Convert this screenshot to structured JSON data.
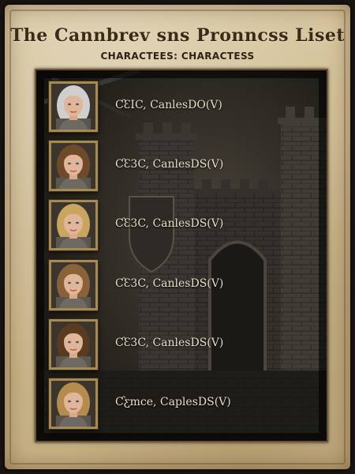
{
  "header": {
    "title": "The Cannbrev sns Pronncss Liset",
    "subtitle": "CHARACTEES: CHARACTESS"
  },
  "characters": [
    {
      "name": "ƇƐIC, CanlesDO(V)",
      "hair": "#cfcfd0"
    },
    {
      "name": "ƇƐ3C, CanlesDS(V)",
      "hair": "#6e4a2a"
    },
    {
      "name": "ƇƐ3C, CanlesDS(V)",
      "hair": "#c9a660"
    },
    {
      "name": "ƇƐ3C, CanlesDS(V)",
      "hair": "#8a6238"
    },
    {
      "name": "ƇƐ3C, CanlesDS(V)",
      "hair": "#5a3a20"
    },
    {
      "name": "Ƈƹmce, CaplesDS(V)",
      "hair": "#b48c4e"
    }
  ]
}
